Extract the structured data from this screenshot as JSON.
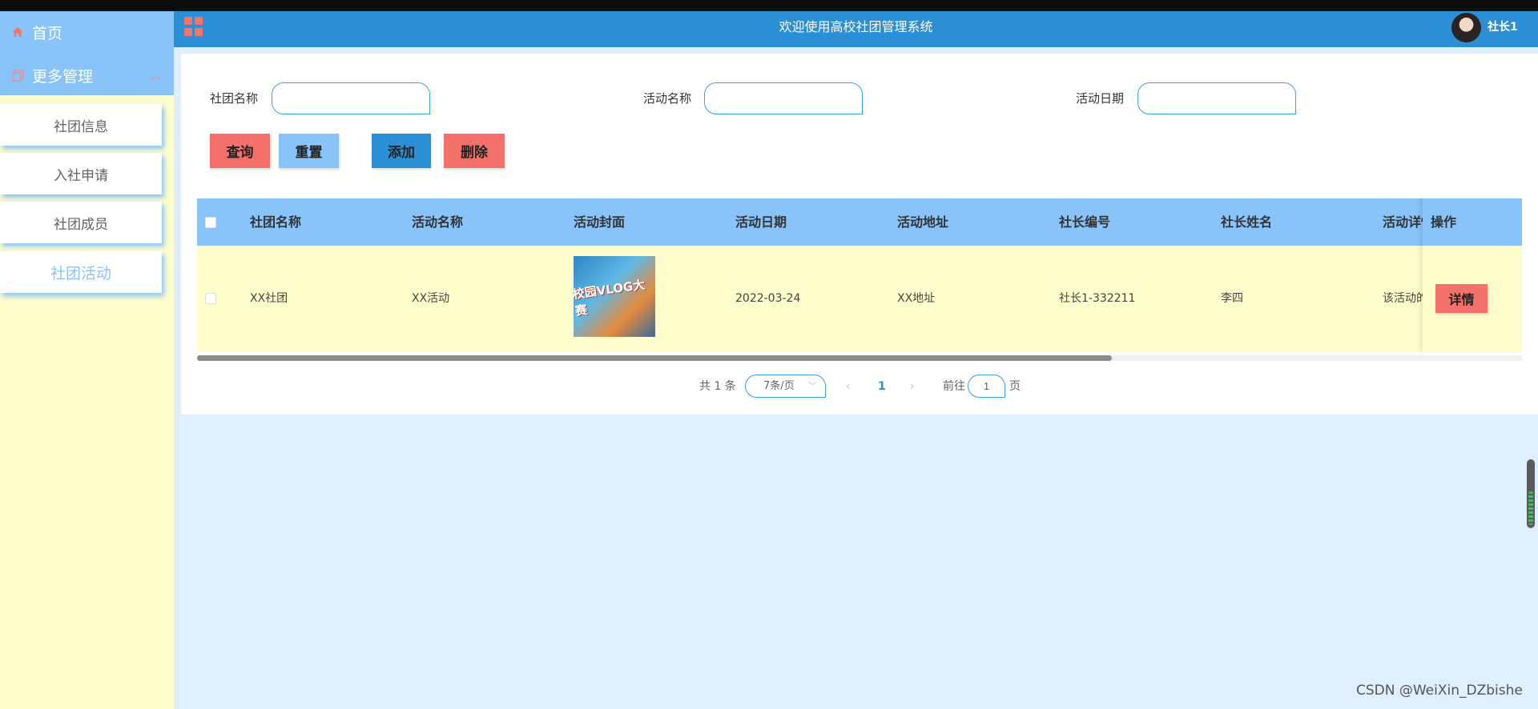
{
  "sidebar": {
    "home_label": "首页",
    "more_label": "更多管理",
    "items": [
      {
        "label": "社团信息"
      },
      {
        "label": "入社申请"
      },
      {
        "label": "社团成员"
      },
      {
        "label": "社团活动"
      }
    ]
  },
  "header": {
    "title": "欢迎使用高校社团管理系统",
    "user": "社长1"
  },
  "search": {
    "club_name_label": "社团名称",
    "activity_name_label": "活动名称",
    "activity_date_label": "活动日期",
    "club_name_value": "",
    "activity_name_value": "",
    "activity_date_value": ""
  },
  "buttons": {
    "query": "查询",
    "reset": "重置",
    "add": "添加",
    "delete": "删除",
    "detail": "详情"
  },
  "table": {
    "columns": [
      "社团名称",
      "活动名称",
      "活动封面",
      "活动日期",
      "活动地址",
      "社长编号",
      "社长姓名",
      "活动详情",
      "操作"
    ],
    "rows": [
      {
        "club_name": "XX社团",
        "activity_name": "XX活动",
        "cover_text": "校园VLOG大赛",
        "activity_date": "2022-03-24",
        "address": "XX地址",
        "leader_id": "社长1-332211",
        "leader_name": "李四",
        "detail": "该活动的"
      }
    ]
  },
  "pagination": {
    "total": "共 1 条",
    "page_size": "7条/页",
    "current_page": "1",
    "goto_prefix": "前往",
    "goto_value": "1",
    "goto_suffix": "页"
  },
  "watermark": "CSDN @WeiXin_DZbishe",
  "colors": {
    "sidebar_head": "#88c3fa",
    "sidebar_bg": "#fefdcb",
    "header": "#2b8fd6",
    "accent_red": "#f3706b",
    "page_bg": "#dfeffd"
  }
}
